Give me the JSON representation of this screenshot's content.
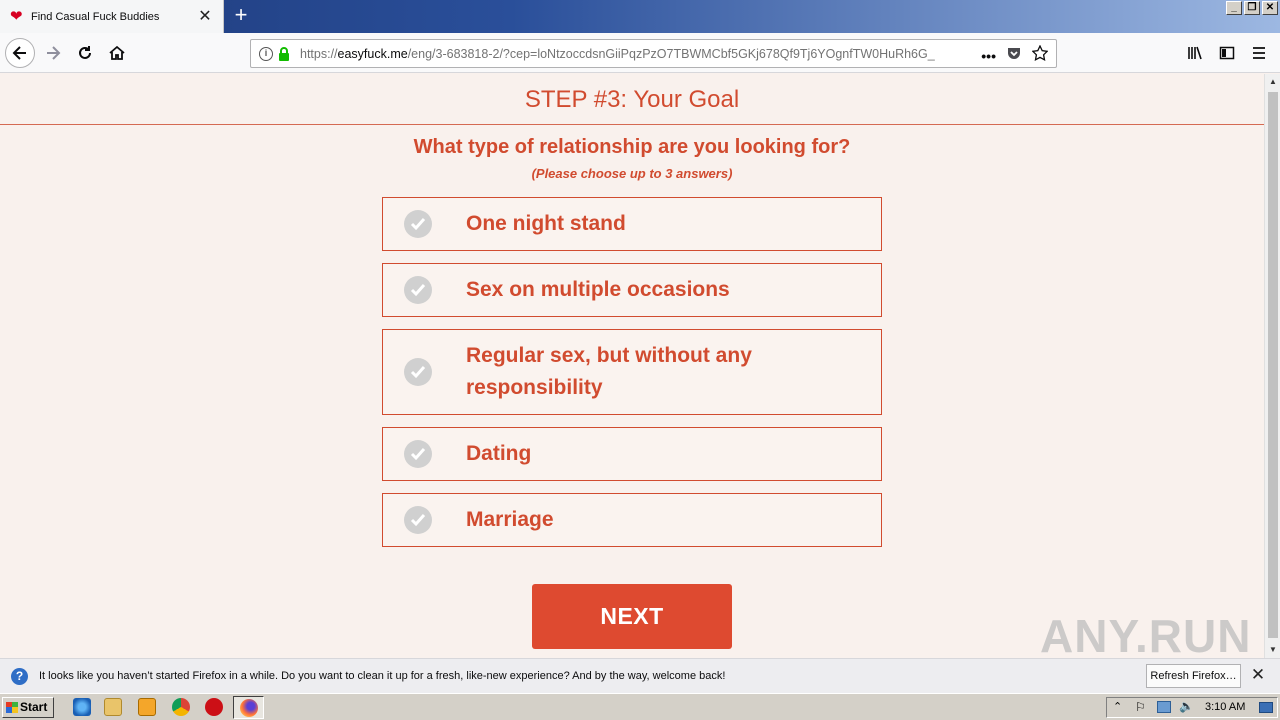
{
  "browser": {
    "tab_title": "Find Casual Fuck Buddies",
    "url_prefix": "https://",
    "url_domain": "easyfuck.me",
    "url_rest": "/eng/3-683818-2/?cep=loNtzoccdsnGiiPqzPzO7TBWMCbf5GKj678Qf9Tj6YOgnfTW0HuRh6G_",
    "window_buttons": [
      "_",
      "❐",
      "✕"
    ]
  },
  "page": {
    "step_title": "STEP #3: Your Goal",
    "question": "What type of relationship are you looking for?",
    "hint": "(Please choose up to 3 answers)",
    "options": [
      {
        "label": "One night stand"
      },
      {
        "label": "Sex on multiple occasions"
      },
      {
        "label": "Regular sex, but without any responsibility"
      },
      {
        "label": "Dating"
      },
      {
        "label": "Marriage"
      }
    ],
    "next_label": "NEXT",
    "watermark": "ANY.RUN"
  },
  "notification": {
    "message": "It looks like you haven’t started Firefox in a while. Do you want to clean it up for a fresh, like-new experience? And by the way, welcome back!",
    "button": "Refresh Firefox…"
  },
  "taskbar": {
    "start_label": "Start",
    "clock": "3:10 AM"
  },
  "colors": {
    "accent": "#d14b2f",
    "button": "#de4a30",
    "page_bg": "#f9f1ed"
  }
}
